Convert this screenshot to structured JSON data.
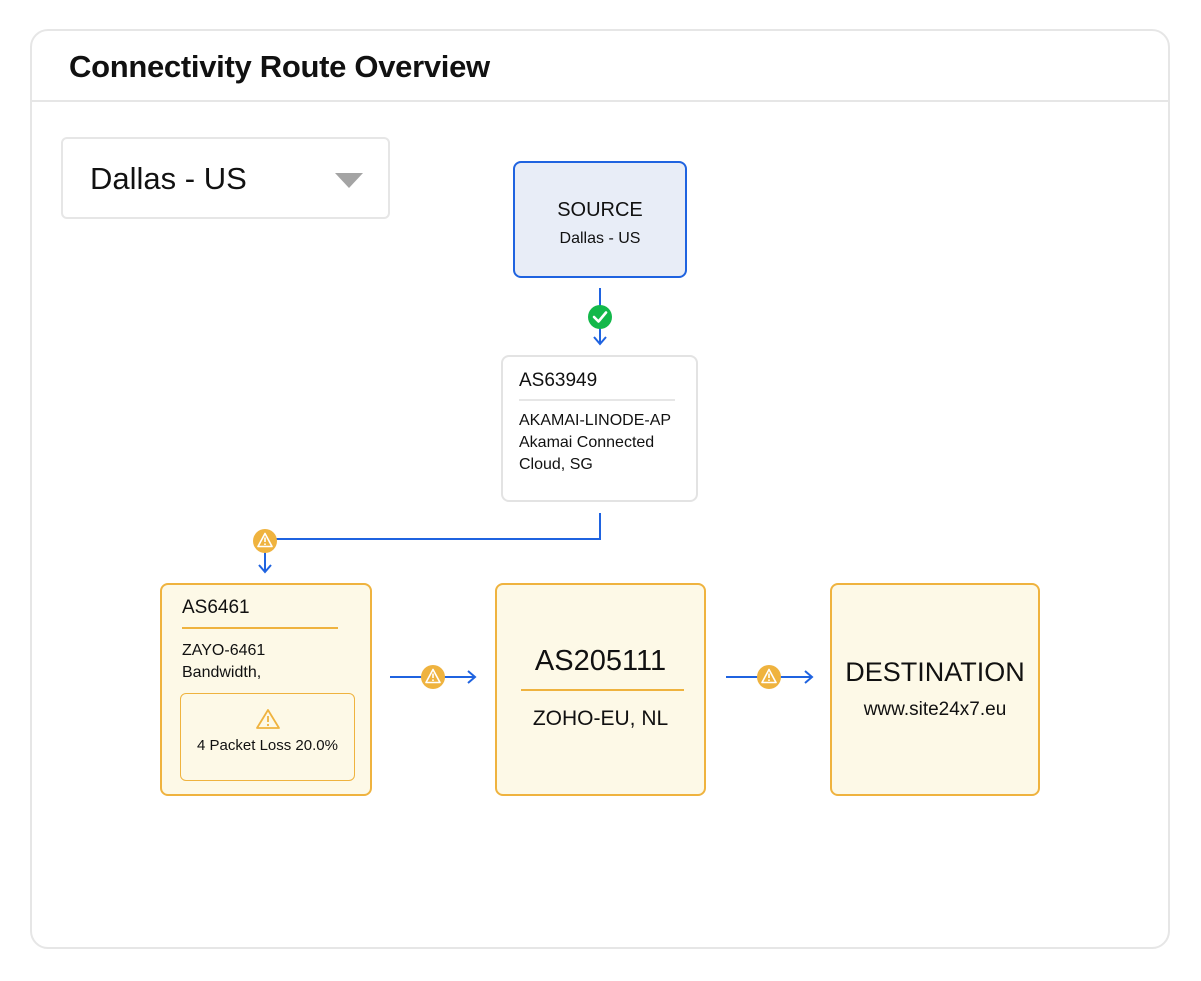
{
  "header": {
    "title": "Connectivity Route Overview"
  },
  "location_select": {
    "value": "Dallas - US"
  },
  "nodes": {
    "source": {
      "title": "SOURCE",
      "subtitle": "Dallas - US"
    },
    "as63949": {
      "title": "AS63949",
      "lines": [
        "AKAMAI-LINODE-AP",
        "Akamai Connected",
        "Cloud, SG"
      ]
    },
    "as6461": {
      "title": "AS6461",
      "lines": [
        "ZAYO-6461",
        "Bandwidth,"
      ],
      "alert": "4 Packet Loss 20.0%"
    },
    "as205111": {
      "title": "AS205111",
      "subtitle": "ZOHO-EU, NL"
    },
    "destination": {
      "title": "DESTINATION",
      "subtitle": "www.site24x7.eu"
    }
  },
  "links": [
    {
      "from": "SOURCE",
      "to": "AS63949",
      "status": "ok"
    },
    {
      "from": "AS63949",
      "to": "AS6461",
      "status": "warning"
    },
    {
      "from": "AS6461",
      "to": "AS205111",
      "status": "warning"
    },
    {
      "from": "AS205111",
      "to": "DESTINATION",
      "status": "warning"
    }
  ],
  "colors": {
    "accent_blue": "#1f63e0",
    "ok_green": "#13b84a",
    "warning_orange": "#efb33f",
    "warning_fill": "#fdf9e7",
    "source_fill": "#e8edf7"
  },
  "icons": {
    "ok": "check-circle-icon",
    "warning": "warning-triangle-icon",
    "dropdown": "chevron-down-icon"
  }
}
